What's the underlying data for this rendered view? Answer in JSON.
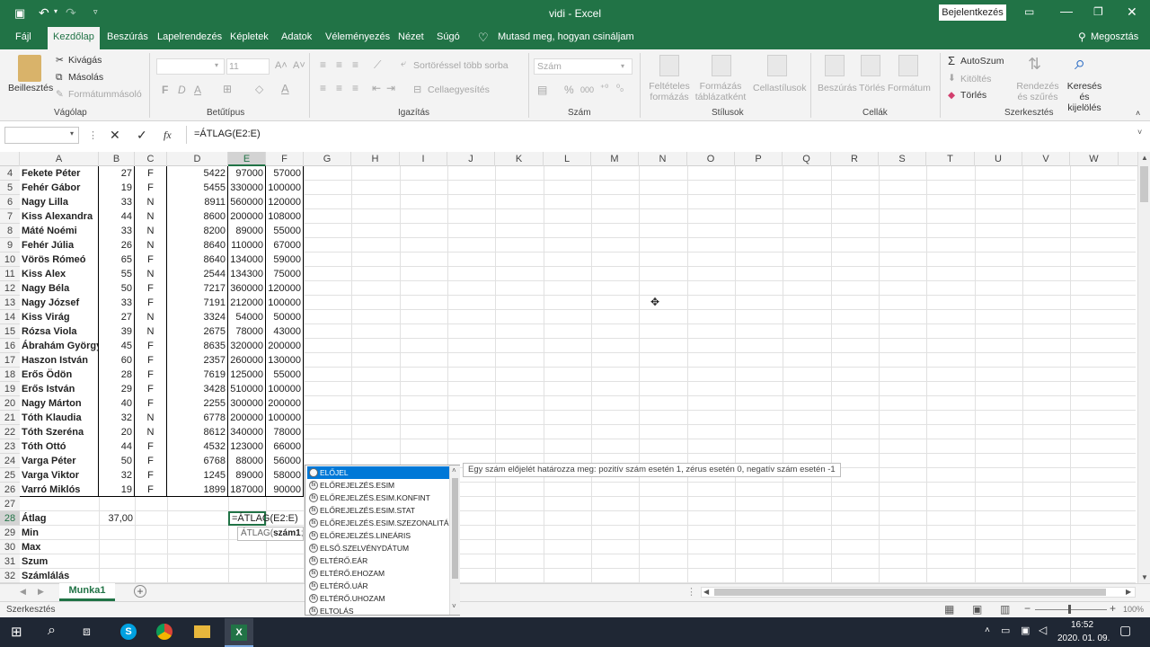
{
  "window": {
    "title": "vidi  -  Excel",
    "signin": "Bejelentkezés"
  },
  "tabs": [
    "Fájl",
    "Kezdőlap",
    "Beszúrás",
    "Lapelrendezés",
    "Képletek",
    "Adatok",
    "Véleményezés",
    "Nézet",
    "Súgó"
  ],
  "tellme": "Mutasd meg, hogyan csináljam",
  "share": "Megosztás",
  "ribbon": {
    "clipboard": {
      "paste": "Beillesztés",
      "cut": "Kivágás",
      "copy": "Másolás",
      "format_painter": "Formátummásoló",
      "label": "Vágólap"
    },
    "font": {
      "size": "11",
      "bold": "F",
      "italic": "D",
      "underline": "A",
      "label": "Betűtípus"
    },
    "align": {
      "wrap": "Sortöréssel több sorba",
      "merge": "Cellaegyesítés",
      "label": "Igazítás"
    },
    "number": {
      "format": "Szám",
      "percent": "%",
      "thousands": "000",
      "label": "Szám"
    },
    "styles": {
      "cond": "Feltételes formázás",
      "table": "Formázás táblázatként",
      "cell": "Cellastílusok",
      "label": "Stílusok"
    },
    "cells": {
      "insert": "Beszúrás",
      "delete": "Törlés",
      "format": "Formátum",
      "label": "Cellák"
    },
    "editing": {
      "autosum": "AutoSzum",
      "fill": "Kitöltés",
      "clear": "Törlés",
      "sort": "Rendezés és szűrés",
      "find": "Keresés és kijelölés",
      "label": "Szerkesztés"
    }
  },
  "formula_bar": {
    "name_box": "",
    "formula": "=ÁTLAG(E2:E)",
    "fx": "fx"
  },
  "columns": [
    "A",
    "B",
    "C",
    "D",
    "E",
    "F",
    "G",
    "H",
    "I",
    "J",
    "K",
    "L",
    "M",
    "N",
    "O",
    "P",
    "Q",
    "R",
    "S",
    "T",
    "U",
    "V",
    "W"
  ],
  "rows": [
    {
      "n": "4",
      "a": "Fekete Péter",
      "b": "27",
      "c": "F",
      "d": "5422",
      "e": "97000",
      "f": "57000"
    },
    {
      "n": "5",
      "a": "Fehér Gábor",
      "b": "19",
      "c": "F",
      "d": "5455",
      "e": "330000",
      "f": "100000"
    },
    {
      "n": "6",
      "a": "Nagy Lilla",
      "b": "33",
      "c": "N",
      "d": "8911",
      "e": "560000",
      "f": "120000"
    },
    {
      "n": "7",
      "a": "Kiss Alexandra",
      "b": "44",
      "c": "N",
      "d": "8600",
      "e": "200000",
      "f": "108000"
    },
    {
      "n": "8",
      "a": "Máté Noémi",
      "b": "33",
      "c": "N",
      "d": "8200",
      "e": "89000",
      "f": "55000"
    },
    {
      "n": "9",
      "a": "Fehér Júlia",
      "b": "26",
      "c": "N",
      "d": "8640",
      "e": "110000",
      "f": "67000"
    },
    {
      "n": "10",
      "a": "Vörös Rómeó",
      "b": "65",
      "c": "F",
      "d": "8640",
      "e": "134000",
      "f": "59000"
    },
    {
      "n": "11",
      "a": "Kiss Alex",
      "b": "55",
      "c": "N",
      "d": "2544",
      "e": "134300",
      "f": "75000"
    },
    {
      "n": "12",
      "a": "Nagy Béla",
      "b": "50",
      "c": "F",
      "d": "7217",
      "e": "360000",
      "f": "120000"
    },
    {
      "n": "13",
      "a": "Nagy József",
      "b": "33",
      "c": "F",
      "d": "7191",
      "e": "212000",
      "f": "100000"
    },
    {
      "n": "14",
      "a": "Kiss Virág",
      "b": "27",
      "c": "N",
      "d": "3324",
      "e": "54000",
      "f": "50000"
    },
    {
      "n": "15",
      "a": "Rózsa Viola",
      "b": "39",
      "c": "N",
      "d": "2675",
      "e": "78000",
      "f": "43000"
    },
    {
      "n": "16",
      "a": "Ábrahám Györgyi",
      "b": "45",
      "c": "F",
      "d": "8635",
      "e": "320000",
      "f": "200000"
    },
    {
      "n": "17",
      "a": "Haszon István",
      "b": "60",
      "c": "F",
      "d": "2357",
      "e": "260000",
      "f": "130000"
    },
    {
      "n": "18",
      "a": "Erős Ödön",
      "b": "28",
      "c": "F",
      "d": "7619",
      "e": "125000",
      "f": "55000"
    },
    {
      "n": "19",
      "a": "Erős István",
      "b": "29",
      "c": "F",
      "d": "3428",
      "e": "510000",
      "f": "100000"
    },
    {
      "n": "20",
      "a": "Nagy Márton",
      "b": "40",
      "c": "F",
      "d": "2255",
      "e": "300000",
      "f": "200000"
    },
    {
      "n": "21",
      "a": "Tóth Klaudia",
      "b": "32",
      "c": "N",
      "d": "6778",
      "e": "200000",
      "f": "100000"
    },
    {
      "n": "22",
      "a": "Tóth Szeréna",
      "b": "20",
      "c": "N",
      "d": "8612",
      "e": "340000",
      "f": "78000"
    },
    {
      "n": "23",
      "a": "Tóth Ottó",
      "b": "44",
      "c": "F",
      "d": "4532",
      "e": "123000",
      "f": "66000"
    },
    {
      "n": "24",
      "a": "Varga Péter",
      "b": "50",
      "c": "F",
      "d": "6768",
      "e": "88000",
      "f": "56000"
    },
    {
      "n": "25",
      "a": "Varga Viktor",
      "b": "32",
      "c": "F",
      "d": "1245",
      "e": "89000",
      "f": "58000"
    },
    {
      "n": "26",
      "a": "Varró Miklós",
      "b": "19",
      "c": "F",
      "d": "1899",
      "e": "187000",
      "f": "90000"
    },
    {
      "n": "27",
      "a": "",
      "b": "",
      "c": "",
      "d": "",
      "e": "",
      "f": ""
    },
    {
      "n": "28",
      "a": "Átlag",
      "b": "37,00",
      "c": "",
      "d": "",
      "e": "=ÁTLAG(E2:E)",
      "f": ""
    },
    {
      "n": "29",
      "a": "Min",
      "b": "",
      "c": "",
      "d": "",
      "e": "",
      "f": ""
    },
    {
      "n": "30",
      "a": "Max",
      "b": "",
      "c": "",
      "d": "",
      "e": "",
      "f": ""
    },
    {
      "n": "31",
      "a": "Szum",
      "b": "",
      "c": "",
      "d": "",
      "e": "",
      "f": ""
    },
    {
      "n": "32",
      "a": "Számlálás",
      "b": "",
      "c": "",
      "d": "",
      "e": "",
      "f": ""
    }
  ],
  "tooltip_hint": {
    "fn": "ÁTLAG(",
    "arg": "szám1",
    "rest": "; "
  },
  "autocomplete": {
    "items": [
      "ELŐJEL",
      "ELŐREJELZÉS.ESIM",
      "ELŐREJELZÉS.ESIM.KONFINT",
      "ELŐREJELZÉS.ESIM.STAT",
      "ELŐREJELZÉS.ESIM.SZEZONALITÁS",
      "ELŐREJELZÉS.LINEÁRIS",
      "ELSŐ.SZELVÉNYDÁTUM",
      "ELTÉRŐ.EÁR",
      "ELTÉRŐ.EHOZAM",
      "ELTÉRŐ.UÁR",
      "ELTÉRŐ.UHOZAM",
      "ELTOLÁS"
    ],
    "selected": 0,
    "description": "Egy szám előjelét határozza meg: pozitív szám esetén 1, zérus esetén 0, negatív szám esetén -1"
  },
  "sheet_tab": "Munka1",
  "status": {
    "mode": "Szerkesztés",
    "zoom": "100%"
  },
  "taskbar": {
    "time": "16:52",
    "date": "2020. 01. 09."
  },
  "colors": {
    "excel_green": "#217346",
    "selection_blue": "#0078d7"
  }
}
